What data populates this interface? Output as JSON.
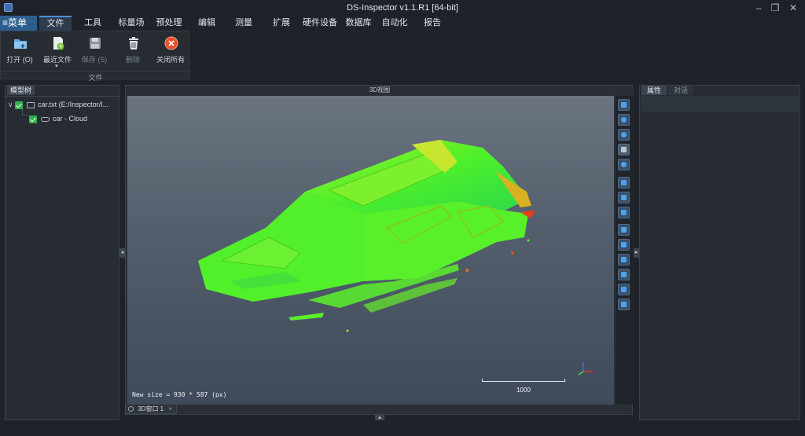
{
  "window": {
    "title": "DS-Inspector v1.1.R1 [64-bit]"
  },
  "menu": {
    "main": "≡菜单",
    "tabs": [
      {
        "label": "文件"
      },
      {
        "label": "工具"
      },
      {
        "label": "标量场"
      },
      {
        "label": "预处理"
      },
      {
        "label": "编辑"
      },
      {
        "label": "测量"
      },
      {
        "label": "扩展"
      },
      {
        "label": "硬件设备"
      },
      {
        "label": "数据库"
      },
      {
        "label": "自动化"
      },
      {
        "label": "报告"
      }
    ]
  },
  "ribbon": {
    "buttons": [
      {
        "label": "打开 (O)",
        "icon": "folder-open-icon"
      },
      {
        "label": "最近文件",
        "icon": "recent-file-icon"
      },
      {
        "label": "保存 (S)",
        "icon": "save-icon"
      },
      {
        "label": "删除",
        "icon": "trash-icon"
      },
      {
        "label": "关闭所有",
        "icon": "close-all-icon"
      }
    ],
    "group_label": "文件"
  },
  "tree_panel": {
    "tab": "模型树",
    "items": [
      {
        "label": "car.txt (E:/Inspector/I..."
      },
      {
        "label": "car - Cloud"
      }
    ]
  },
  "viewer": {
    "title": "3D视图",
    "status": "New size = 930 * 587 (px)",
    "scale_label": "1000",
    "bottom_tab": "3D窗口 1"
  },
  "right_panel": {
    "tabs": [
      {
        "label": "属性"
      },
      {
        "label": "对话"
      }
    ]
  },
  "colors": {
    "accent": "#2c5f8f",
    "cloud_green": "#58f02a",
    "check_green": "#2eb34a"
  }
}
